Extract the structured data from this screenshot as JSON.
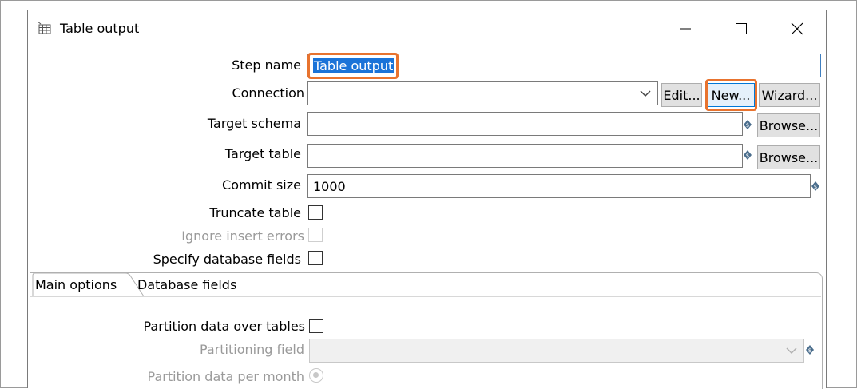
{
  "window": {
    "title": "Table output",
    "controls": {
      "minimize": "minimize",
      "maximize": "maximize",
      "close": "close"
    }
  },
  "form": {
    "step_name": {
      "label": "Step name",
      "value": "Table output"
    },
    "connection": {
      "label": "Connection",
      "value": "",
      "buttons": {
        "edit": "Edit...",
        "new": "New...",
        "wizard": "Wizard..."
      }
    },
    "target_schema": {
      "label": "Target schema",
      "value": "",
      "browse": "Browse..."
    },
    "target_table": {
      "label": "Target table",
      "value": "",
      "browse": "Browse..."
    },
    "commit_size": {
      "label": "Commit size",
      "value": "1000"
    },
    "truncate_table": {
      "label": "Truncate table",
      "checked": false
    },
    "ignore_insert_errors": {
      "label": "Ignore insert errors",
      "checked": false,
      "disabled": true
    },
    "specify_database_fields": {
      "label": "Specify database fields",
      "checked": false
    }
  },
  "tabs": [
    {
      "label": "Main options",
      "active": true
    },
    {
      "label": "Database fields",
      "active": false
    }
  ],
  "main_options": {
    "partition_data_over_tables": {
      "label": "Partition data over tables",
      "checked": false
    },
    "partitioning_field": {
      "label": "Partitioning field",
      "value": "",
      "disabled": true
    },
    "partition_data_per_month": {
      "label": "Partition data per month",
      "disabled": true
    }
  },
  "colors": {
    "highlight": "#e8732e",
    "selection": "#1a73d8"
  }
}
